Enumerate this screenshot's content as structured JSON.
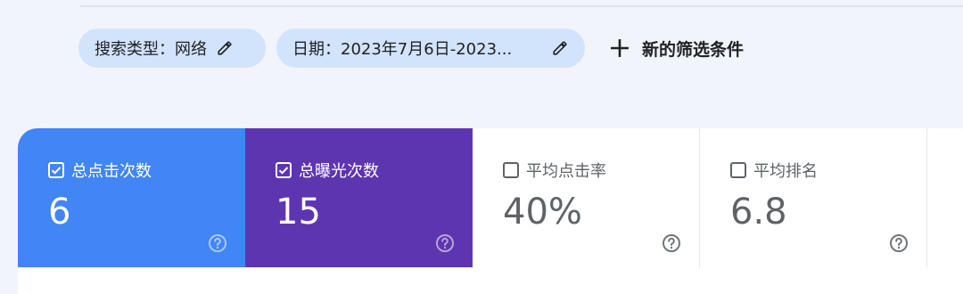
{
  "filters": {
    "search_type": "搜索类型：网络",
    "date": "日期：2023年7月6日-2023...",
    "new_filter": "新的筛选条件"
  },
  "metrics": [
    {
      "title": "总点击次数",
      "value": "6",
      "checked": true,
      "color": "#4285f4"
    },
    {
      "title": "总曝光次数",
      "value": "15",
      "checked": true,
      "color": "#5e35b1"
    },
    {
      "title": "平均点击率",
      "value": "40%",
      "checked": false,
      "color": "#ffffff"
    },
    {
      "title": "平均排名",
      "value": "6.8",
      "checked": false,
      "color": "#ffffff"
    }
  ],
  "icons": {
    "edit": "pencil-icon",
    "add": "plus-icon",
    "checkbox_checked": "checkbox-checked-icon",
    "checkbox_unchecked": "checkbox-unchecked-icon",
    "help": "help-icon"
  }
}
